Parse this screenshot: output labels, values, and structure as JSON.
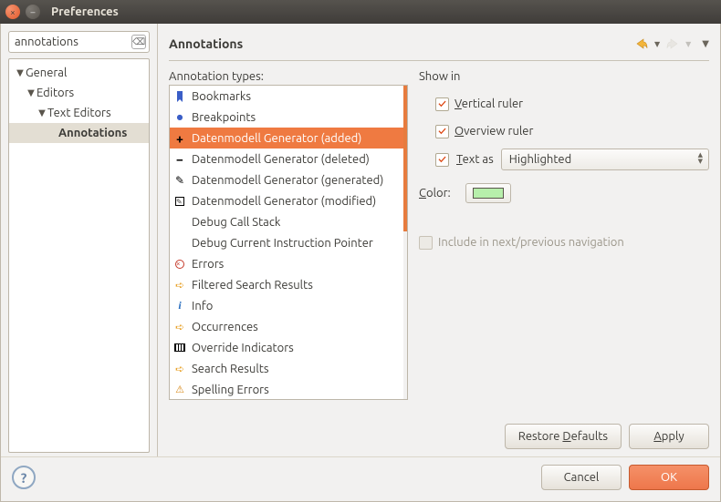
{
  "window": {
    "title": "Preferences"
  },
  "search": {
    "value": "annotations"
  },
  "tree": {
    "items": [
      {
        "label": "General"
      },
      {
        "label": "Editors"
      },
      {
        "label": "Text Editors"
      },
      {
        "label": "Annotations"
      }
    ],
    "selected_index": 3
  },
  "page": {
    "title": "Annotations",
    "list_caption": "Annotation types:"
  },
  "annotation_types": [
    {
      "label": "Bookmarks",
      "icon": "bookmark"
    },
    {
      "label": "Breakpoints",
      "icon": "bullet"
    },
    {
      "label": "Datenmodell Generator (added)",
      "icon": "plus",
      "selected": true
    },
    {
      "label": "Datenmodell Generator (deleted)",
      "icon": "minus"
    },
    {
      "label": "Datenmodell Generator (generated)",
      "icon": "pencil"
    },
    {
      "label": "Datenmodell Generator (modified)",
      "icon": "edit"
    },
    {
      "label": "Debug Call Stack",
      "icon": ""
    },
    {
      "label": "Debug Current Instruction Pointer",
      "icon": ""
    },
    {
      "label": "Errors",
      "icon": "error"
    },
    {
      "label": "Filtered Search Results",
      "icon": "arrow"
    },
    {
      "label": "Info",
      "icon": "info"
    },
    {
      "label": "Occurrences",
      "icon": "arrow"
    },
    {
      "label": "Override Indicators",
      "icon": "override"
    },
    {
      "label": "Search Results",
      "icon": "arrow"
    },
    {
      "label": "Spelling Errors",
      "icon": "warn"
    }
  ],
  "detail": {
    "showin_caption": "Show in",
    "vertical_ruler": "Vertical ruler",
    "overview_ruler": "Overview ruler",
    "text_as": "Text as",
    "text_as_value": "Highlighted",
    "color_label": "Color:",
    "color_value": "#b7efab",
    "include_nav": "Include in next/previous navigation",
    "checks": {
      "vertical": true,
      "overview": true,
      "text_as": true,
      "include_nav": false
    }
  },
  "buttons": {
    "restore_defaults": "Restore Defaults",
    "apply": "Apply",
    "cancel": "Cancel",
    "ok": "OK"
  }
}
